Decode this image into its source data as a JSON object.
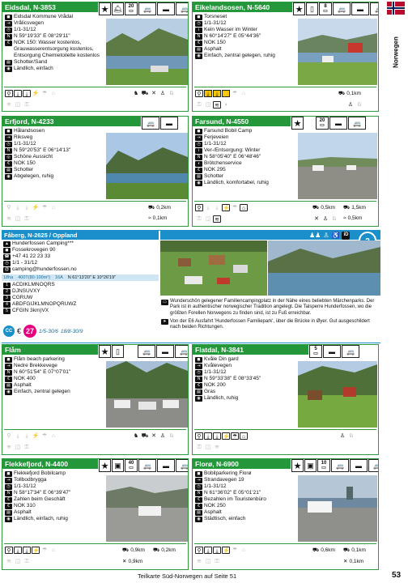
{
  "side_label": "Norwegen",
  "footer": {
    "text": "Teilkarte Süd-Norwegen auf Seite 51",
    "page": "53"
  },
  "cards": [
    {
      "title": "Eidsdal, N-3853",
      "badge": "20",
      "info": [
        "Eidsdal Kommune Vrådal",
        "Vrålicsvegen",
        "1/1-31/12",
        "N 59°19'33\"  E 08°29'11\"",
        "NOK 150: Wasser kostenlos, Grauwasserentsorgung kostenlos, Entsorgung Chemietoilette kostenlos",
        "Schotter/Sand",
        "Ländlich, einfach"
      ],
      "dist": []
    },
    {
      "title": "Eikelandsosen, N-5640",
      "badge": "8",
      "info": [
        "Torsneset",
        "1/1-31/12",
        "Kein Wasser im Winter",
        "N 60°14'27\"  E 05°44'36\"",
        "NOK 150",
        "Asphalt",
        "Einfach, zentral gelegen, ruhig"
      ],
      "dist": [
        "0,1km"
      ]
    },
    {
      "title": "Erfjord, N-4233",
      "badge": "",
      "info": [
        "Hålandsosen",
        "Riksveg",
        "1/1-31/12",
        "N 59°20'53\"  E 06°14'13\"",
        "Schöne Aussicht",
        "NOK 150",
        "Schotter",
        "Abgelegen, ruhig"
      ],
      "dist": [
        "0,2km",
        "0,1km"
      ]
    },
    {
      "title": "Farsund, N-4550",
      "badge": "20",
      "info": [
        "Farsund Bobil Camp",
        "Ferjeveien",
        "1/1-31/12",
        "Ver-/Entsorgung: Winter",
        "N 58°05'40\"  E 06°48'46\"",
        "Brötchenservice",
        "NOK 295",
        "Schotter",
        "Ländlich, komfortabel, ruhig"
      ],
      "dist": [
        "0,5km",
        "1,5km",
        "0,5km"
      ]
    },
    {
      "title": "Flåm",
      "badge": "",
      "info": [
        "Flåm beach parkering",
        "Nedre Brekkevege",
        "N 60°51'54\"  E 07°07'01\"",
        "NOK 400",
        "Asphalt",
        "Einfach, zentral gelegen"
      ],
      "dist": []
    },
    {
      "title": "Flatdal, N-3841",
      "badge": "5",
      "info": [
        "Kvåle Din gard",
        "Kvålevegen",
        "1/1-31/12",
        "N 59°33'38\"  E 08°33'45\"",
        "NOK 200",
        "Gras",
        "Ländlich, ruhig"
      ],
      "dist": []
    },
    {
      "title": "Flekkefjord, N-4400",
      "badge": "40",
      "info": [
        "Flekkefjord Bobilcamp",
        "Tollbodbrygga",
        "1/1-31/12",
        "N 58°17'34\"  E 06°39'47\"",
        "Zahlen beim Geschäft",
        "NOK 310",
        "Asphalt",
        "Ländlich, einfach, ruhig"
      ],
      "dist": [
        "0,9km",
        "0,2km",
        "0,9km"
      ]
    },
    {
      "title": "Florø, N-6900",
      "badge": "10",
      "info": [
        "Bobilparkering Florø",
        "Strandavegen 19",
        "1/1-31/12",
        "N 61°36'02\"  E 05°01'21\"",
        "Bezahlen im Touristenbüro",
        "NOK 250",
        "Asphalt",
        "Städtisch, einfach"
      ],
      "dist": [
        "0,6km",
        "0,1km",
        "0,1km"
      ]
    }
  ],
  "feature": {
    "title": "Fåberg, N-2625 / Oppland",
    "badge_id": "iD",
    "number": "2",
    "info": [
      "Hunderfossen Camping***",
      "Fossekrovegen 90",
      "+47 41 22 23 33",
      "1/1 - 31/12",
      "camping@hunderfossen.no"
    ],
    "size_row": [
      "18ha",
      "400T(80-100m²)",
      "16A",
      "N 61°13'20\"  E 10°26'19\""
    ],
    "ratings": [
      "ACDIKLMNOQRS",
      "DJNSUVXY",
      "CGRUW",
      "ABDFGIJKLMNOPQRUWZ",
      "CFGIN 3km)VX"
    ],
    "price": "27",
    "dates": [
      "1/5-30/6",
      "18/8-30/9"
    ],
    "desc1": "Wunderschön gelegener Familiencampingplatz in der Nähe eines beliebten Märchenparks. Der Park ist in authentischer norwegischer Tradition angelegt. Die Talsperre Hunderfossen, wo die größten Forellen Norwegens zu finden sind, ist zu Fuß erreichbar.",
    "desc2": "Von der E6 Ausfahrt 'Hunderfossen Familiepark', über die Brücke in Øyer. Gut ausgeschildert nach beiden Richtungen."
  }
}
